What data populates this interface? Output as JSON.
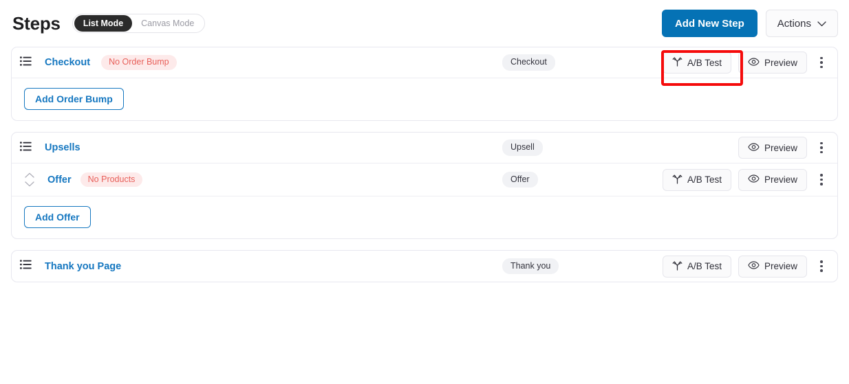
{
  "header": {
    "title": "Steps",
    "mode_toggle": {
      "active": "List Mode",
      "inactive": "Canvas Mode"
    },
    "add_new_step_label": "Add New Step",
    "actions_label": "Actions",
    "chevron_icon": "chevron-down-icon",
    "primary_color": "#0572b5"
  },
  "labels": {
    "ab_test": "A/B Test",
    "preview": "Preview",
    "ab_test_icon": "split-branch-icon",
    "preview_icon": "eye-icon",
    "menu_icon": "kebab-menu-icon",
    "drag_icon": "list-handle-icon",
    "sort_icon": "sort-updown-icon"
  },
  "colors": {
    "link": "#1577c0",
    "warning_badge_bg": "#fdeaea",
    "warning_badge_text": "#e8605a",
    "type_badge_bg": "#f1f2f5",
    "card_border": "#e7e7ef",
    "highlight": "#f50b0b"
  },
  "cards": [
    {
      "id": "checkout",
      "rows": [
        {
          "name": "Checkout",
          "warning": "No Order Bump",
          "type": "Checkout",
          "has_ab_test": true,
          "has_preview": true,
          "has_menu": true,
          "highlighted": true
        }
      ],
      "footer_button": "Add Order Bump"
    },
    {
      "id": "upsells",
      "rows": [
        {
          "name": "Upsells",
          "warning": null,
          "type": "Upsell",
          "has_ab_test": false,
          "has_preview": true,
          "has_menu": true,
          "highlighted": false
        },
        {
          "name": "Offer",
          "warning": "No Products",
          "type": "Offer",
          "has_ab_test": true,
          "has_preview": true,
          "has_menu": true,
          "highlighted": false,
          "sub": true
        }
      ],
      "footer_button": "Add Offer"
    },
    {
      "id": "thank-you",
      "rows": [
        {
          "name": "Thank you Page",
          "warning": null,
          "type": "Thank you",
          "has_ab_test": true,
          "has_preview": true,
          "has_menu": true,
          "highlighted": false
        }
      ],
      "footer_button": null
    }
  ]
}
